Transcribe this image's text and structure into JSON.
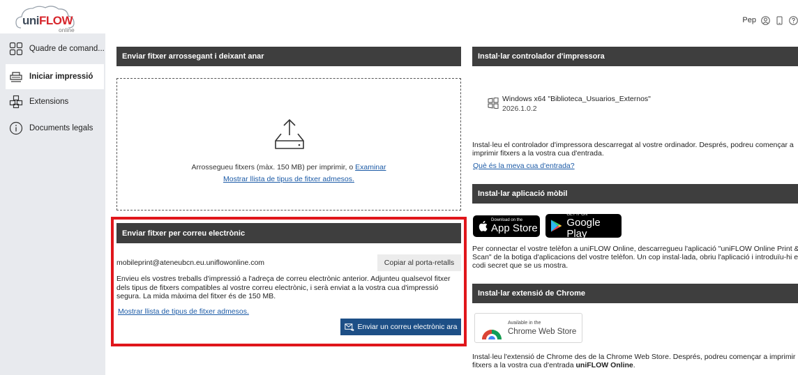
{
  "brand": {
    "logo_uni": "uni",
    "logo_flow": "FLOW",
    "logo_sub": "online"
  },
  "user": {
    "name": "Pep",
    "icons": [
      "user-circle-icon",
      "mobile-device-icon",
      "help-circle-icon"
    ]
  },
  "sidebar": {
    "items": [
      {
        "label": "Quadre de comand...",
        "icon": "dashboard-grid-icon",
        "active": false
      },
      {
        "label": "Iniciar impressió",
        "icon": "printer-icon",
        "active": true
      },
      {
        "label": "Extensions",
        "icon": "extensions-cubes-icon",
        "active": false
      },
      {
        "label": "Documents legals",
        "icon": "info-circle-icon",
        "active": false
      }
    ]
  },
  "upload": {
    "header": "Enviar fitxer arrossegant i deixant anar",
    "drop_text": "Arrossegueu fitxers (màx. 150 MB) per imprimir, o",
    "browse_link": "Examinar",
    "types_link": "Mostrar llista de tipus de fitxer admesos."
  },
  "email": {
    "header": "Enviar fitxer per correu electrònic",
    "address": "mobileprint@ateneubcn.eu.uniflowonline.com",
    "copy_button": "Copiar al porta-retalls",
    "description": "Envieu els vostres treballs d'impressió a l'adreça de correu electrònic anterior. Adjunteu qualsevol fitxer dels tipus de fitxers compatibles al vostre correu electrònic, i serà enviat a la vostra cua d'impressió segura. La mida màxima del fitxer és de 150 MB.",
    "types_link": "Mostrar llista de tipus de fitxer admesos.",
    "send_button": "Enviar un correu electrònic ara",
    "highlight_color": "#e0161b"
  },
  "driver": {
    "header": "Instal·lar controlador d'impressora",
    "name": "Windows x64 \"Biblioteca_Usuarios_Externos\"",
    "version": "2026.1.0.2",
    "description": "Instal·leu el controlador d'impressora descarregat al vostre ordinador. Després, podreu començar a\nimprimir fitxers a la vostra cua d'entrada.",
    "queue_link": "Què és la meva cua d'entrada?"
  },
  "mobile": {
    "header": "Instal·lar aplicació mòbil",
    "appstore_small": "Download on the",
    "appstore_big": "App Store",
    "googleplay_small": "GET IT ON",
    "googleplay_big": "Google Play",
    "description": "Per connectar el vostre telèfon a uniFLOW Online, descarregueu l'aplicació \"uniFLOW Online Print &\nScan\" de la botiga d'aplicacions del vostre telèfon. Un cop instal·lada, obriu l'aplicació i introduïu-hi el\ncodi secret que se us mostra."
  },
  "chrome": {
    "header": "Instal·lar extensió de Chrome",
    "store_small": "Available in the",
    "store_big": "Chrome Web Store",
    "description_pre": "Instal·leu l'extensió de Chrome des de la Chrome Web Store. Després, podreu començar a imprimir fitxers a la vostra cua d'entrada ",
    "description_bold": "uniFLOW Online",
    "description_post": "."
  }
}
